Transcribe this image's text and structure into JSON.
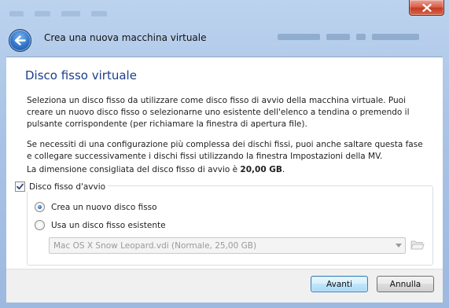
{
  "window": {
    "close_icon": "close-icon",
    "title": "Crea una nuova macchina virtuale",
    "back_icon": "back-arrow-icon"
  },
  "page": {
    "heading": "Disco fisso virtuale",
    "paragraph1": "Seleziona un disco fisso da utilizzare come disco fisso di avvio della macchina virtuale. Puoi creare un nuovo disco fisso o selezionarne uno esistente dell'elenco a tendina o premendo il pulsante corrispondente (per richiamare la finestra di apertura file).",
    "paragraph2": "Se necessiti di una configurazione più complessa dei dischi fissi, puoi anche saltare questa fase e collegare successivamente i dischi fissi utilizzando la finestra Impostazioni della MV.",
    "recommended_prefix": "La dimensione consigliata del disco fisso di avvio è ",
    "recommended_size": "20,00 GB",
    "recommended_suffix": "."
  },
  "boot_disk": {
    "checkbox_label": "Disco fisso d'avvio",
    "checked": true,
    "options": [
      {
        "label": "Crea un nuovo disco fisso",
        "selected": true
      },
      {
        "label": "Usa un disco fisso esistente",
        "selected": false
      }
    ],
    "existing_disk_value": "Mac OS X Snow Leopard.vdi (Normale, 25,00 GB)",
    "folder_icon": "folder-open-icon"
  },
  "footer": {
    "next_label": "Avanti",
    "cancel_label": "Annulla"
  },
  "colors": {
    "heading": "#1c3e8a",
    "primary_button_border": "#3c7fb1",
    "frame": "#a9c4e6",
    "close_button": "#c43c23"
  }
}
